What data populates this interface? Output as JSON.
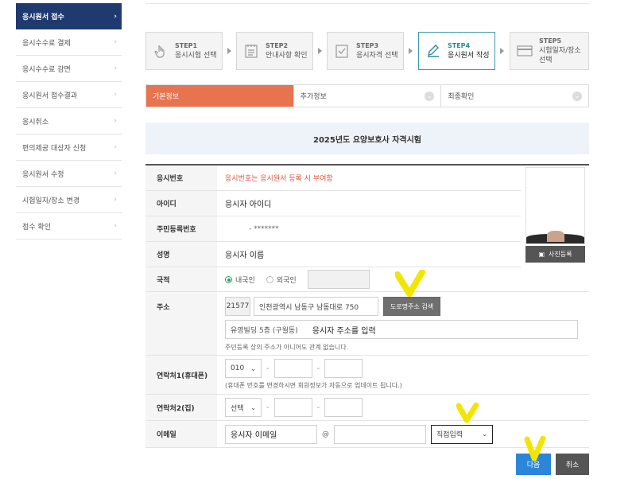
{
  "sidebar": {
    "items": [
      {
        "label": "응시원서 접수",
        "active": true
      },
      {
        "label": "응시수수료 결제"
      },
      {
        "label": "응시수수료 감면"
      },
      {
        "label": "응시원서 접수결과"
      },
      {
        "label": "응시취소"
      },
      {
        "label": "편의제공 대상자 신청"
      },
      {
        "label": "응시원서 수정"
      },
      {
        "label": "시험일자/장소 변경"
      },
      {
        "label": "점수 확인"
      }
    ]
  },
  "steps": [
    {
      "num": "STEP1",
      "name": "응시시험 선택",
      "icon": "hand-pointer-icon"
    },
    {
      "num": "STEP2",
      "name": "안내사항 확인",
      "icon": "notice-list-icon"
    },
    {
      "num": "STEP3",
      "name": "응시자격 선택",
      "icon": "checkbox-icon"
    },
    {
      "num": "STEP4",
      "name": "응시원서 작성",
      "icon": "pen-icon",
      "active": true
    },
    {
      "num": "STEP5",
      "name": "시험일자/장소 선택",
      "icon": "card-icon"
    }
  ],
  "tabs": [
    {
      "label": "기본정보",
      "active": true
    },
    {
      "label": "추가정보"
    },
    {
      "label": "최종확인"
    }
  ],
  "exam_title": "2025년도 요양보호사 자격시험",
  "form": {
    "exam_no": {
      "label": "응시번호",
      "value": "응시번호는 응시원서 등록 시 부여함"
    },
    "user_id": {
      "label": "아이디",
      "value": "응시자 아이디"
    },
    "resident_no": {
      "label": "주민등록번호",
      "value": "- *******"
    },
    "name": {
      "label": "성명",
      "value": "응시자 이름"
    },
    "nationality": {
      "label": "국적",
      "option_domestic": "내국인",
      "option_foreign": "외국인",
      "selected": "내국인"
    },
    "address": {
      "label": "주소",
      "zipcode": "21577",
      "road_address": "인천광역시 남동구 남동대로 750",
      "search_button": "도로명주소 검색",
      "detail_address": "유영빌딩 5층 (구월동)",
      "detail_entered": "응시자 주소를 입력",
      "note": "주민등록 상의 주소가 아니어도 관계 없습니다."
    },
    "mobile": {
      "label": "연락처1(휴대폰)",
      "prefix": "010",
      "note": "(휴대폰 번호를 변경하시면 회원정보가 자동으로 업데이트 됩니다.)"
    },
    "home_phone": {
      "label": "연락처2(집)",
      "prefix": "선택"
    },
    "email": {
      "label": "이메일",
      "local": "응시자 이메일",
      "at": "@",
      "domain_select": "직접입력"
    }
  },
  "photo": {
    "button_label": "사진등록"
  },
  "buttons": {
    "next": "다음",
    "cancel": "취소"
  },
  "colors": {
    "sidebar_active": "#1f3a6e",
    "tab_active": "#e8734f",
    "next_button": "#2b86d9",
    "marker": "#f2e500"
  }
}
